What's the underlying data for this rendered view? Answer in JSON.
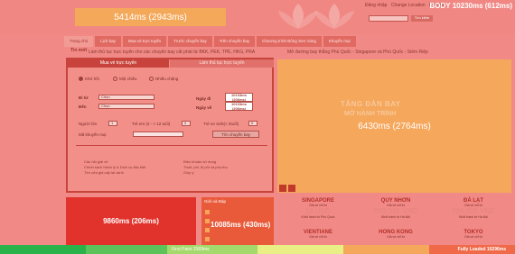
{
  "header": {
    "logo_timing": "5414ms (2943ms)",
    "body_timing": "BODY 10230ms (612ms)",
    "top_links": [
      "Đăng nhập",
      "Change Location",
      "Liên hệ"
    ],
    "search_button": "Tìm kiếm"
  },
  "nav": {
    "items": [
      "Trang chủ",
      "Lịch bay",
      "Mua vé trực tuyến",
      "Trước chuyến bay",
      "Trên chuyến bay",
      "Chương trình Bông Sen Vàng",
      "Khuyến mại"
    ]
  },
  "news": {
    "label": "Tin mới",
    "line1": "Làm thủ tục trực tuyến cho các chuyến bay cất phát từ BKK, PEK, TPE, HKG, PRA",
    "line2": "Mở đường bay thẳng Phú Quốc - Singapore và Phú Quốc - Siêm Riệp"
  },
  "form": {
    "tab_buy": "Mua vé trực tuyến",
    "tab_checkin": "Làm thủ tục trực tuyến",
    "radios": [
      "Khứ hồi",
      "Một chiều",
      "Nhiều chặng"
    ],
    "from_label": "Đi từ",
    "to_label": "Đến",
    "from_value": "Chọn",
    "to_value": "Chọn",
    "depart_label": "Ngày đi",
    "return_label": "Ngày về",
    "date_timing_1": "10103ms (206ms)",
    "date_timing_2": "10103ms (206ms)",
    "adult_label": "Người lớn",
    "child_label": "Trẻ em (2 - < 12 tuổi)",
    "infant_label": "Trẻ sơ sinh(< 2tuổi)",
    "adult_value": "1",
    "child_value": "0",
    "infant_value": "0",
    "promo_label": "Mã khuyến mại",
    "find_button": "Tìm chuyến bay",
    "notes": [
      "Câu hỏi giải về",
      "Điều khoản sử dụng",
      "Chính sách Hành lý & Dịch vụ đặc biệt",
      "Thuế, phí, lệ phí và phụ thu",
      "Tìm cửa giá cấp lại vành",
      "Giúp ý"
    ]
  },
  "promo": {
    "timing": "6430ms (2764ms)",
    "headline": "TĂNG ĐÀN BAY",
    "subline": "MỞ HÀNH TRÌNH"
  },
  "bottom": {
    "left_timing": "9860ms (206ms)",
    "mid_title": "Giới và Đáp",
    "mid_timing": "10085ms (430ms)"
  },
  "destinations": [
    {
      "city": "SINGAPORE",
      "from": "Giá vé chỉ từ",
      "price": "18 USD",
      "route": "Khởi hành từ Phú Quốc"
    },
    {
      "city": "QUY NHƠN",
      "from": "Giá vé chỉ từ",
      "price": "999.000 VND",
      "route": "Khởi hành từ Hà Nội"
    },
    {
      "city": "ĐÀ LẠT",
      "from": "Giá vé chỉ từ",
      "price": "999.000 VND",
      "route": "Khởi hành từ Hà Nội"
    },
    {
      "city": "VIENTIANE",
      "from": "Giá vé chỉ từ",
      "price": "",
      "route": ""
    },
    {
      "city": "HONG KONG",
      "from": "Giá vé chỉ từ",
      "price": "",
      "route": ""
    },
    {
      "city": "TOKYO",
      "from": "Giá vé chỉ từ",
      "price": "",
      "route": ""
    }
  ],
  "timeline": {
    "first_paint": "First Paint 3369ms",
    "fully_loaded": "Fully Loaded 10296ms",
    "colors": [
      "#29b34a",
      "#5cc25a",
      "#a4d96c",
      "#e9ef85",
      "#f5a75c",
      "#f06a4a",
      "#d92b2b"
    ]
  }
}
